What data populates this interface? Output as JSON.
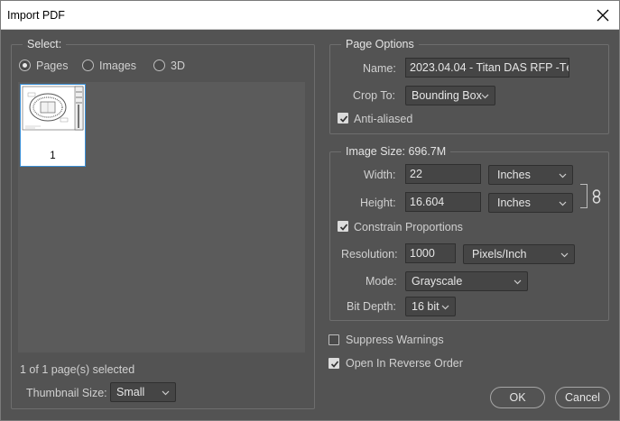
{
  "window": {
    "title": "Import PDF"
  },
  "select": {
    "label": "Select:",
    "options": [
      {
        "label": "Pages",
        "checked": true
      },
      {
        "label": "Images",
        "checked": false
      },
      {
        "label": "3D",
        "checked": false
      }
    ],
    "thumbnail": {
      "page_number": "1"
    },
    "selection_status": "1 of 1 page(s) selected",
    "thumbnail_size": {
      "label": "Thumbnail Size:",
      "value": "Small"
    }
  },
  "page_options": {
    "label": "Page Options",
    "name_label": "Name:",
    "name_value": "2023.04.04 - Titan DAS RFP -Tе",
    "crop_to_label": "Crop To:",
    "crop_to_value": "Bounding Box",
    "anti_aliased_label": "Anti-aliased",
    "anti_aliased": true
  },
  "image_size": {
    "label": "Image Size: 696.7M",
    "width_label": "Width:",
    "width_value": "22",
    "width_unit": "Inches",
    "height_label": "Height:",
    "height_value": "16.604",
    "height_unit": "Inches",
    "constrain_label": "Constrain Proportions",
    "constrain": true,
    "resolution_label": "Resolution:",
    "resolution_value": "1000",
    "resolution_unit": "Pixels/Inch",
    "mode_label": "Mode:",
    "mode_value": "Grayscale",
    "bit_depth_label": "Bit Depth:",
    "bit_depth_value": "16 bit"
  },
  "options": {
    "suppress_warnings_label": "Suppress Warnings",
    "suppress_warnings": false,
    "reverse_order_label": "Open In Reverse Order",
    "reverse_order": true
  },
  "buttons": {
    "ok": "OK",
    "cancel": "Cancel"
  },
  "icons": {
    "close": "close-icon",
    "chevron": "chevron-down-icon",
    "link": "link-icon"
  },
  "colors": {
    "background": "#535353",
    "field": "#454545",
    "selection": "#3a8fd6"
  }
}
